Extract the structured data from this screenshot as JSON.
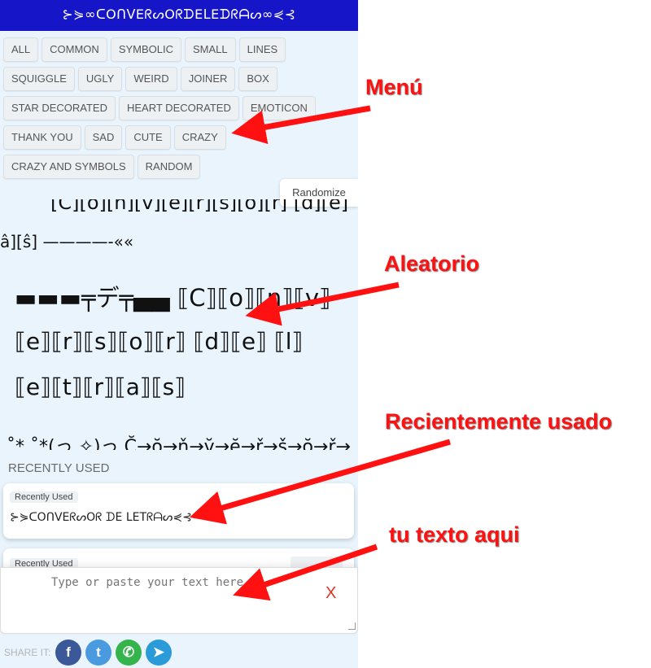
{
  "header": {
    "title": "⊱⋟∞ᑕOᑎᐯEᖇᔕOᖇᗪEᒪEᗪᖇᗩᔕ∞⋞⊰"
  },
  "menu": {
    "items": [
      "ALL",
      "COMMON",
      "SYMBOLIC",
      "SMALL",
      "LINES",
      "SQUIGGLE",
      "UGLY",
      "WEIRD",
      "JOINER",
      "BOX",
      "STAR DECORATED",
      "HEART DECORATED",
      "EMOTICON",
      "THANK YOU",
      "SAD",
      "CUTE",
      "CRAZY",
      "CRAZY AND SYMBOLS",
      "RANDOM"
    ]
  },
  "randomize_label": "Randomize",
  "preview": {
    "lines": [
      "[C][o][n][v][e][r][s][o][r] [d][e]",
      "â][ŝ]    ————-««",
      "▬▬▬╤デ╤▄▄ ⟦C⟧⟦o⟧⟦n⟧⟦v⟧",
      "⟦e⟧⟦r⟧⟦s⟧⟦o⟧⟦r⟧ ⟦d⟧⟦e⟧ ⟦l⟧",
      "⟦e⟧⟦t⟧⟦r⟧⟦a⟧⟦s⟧",
      "˚*.˚*(っ ✧)っ C̆→ŏ→ň→v̆→ĕ→ř→š→ŏ→ř→"
    ]
  },
  "recently_used": {
    "title": "RECENTLY USED",
    "cards": [
      {
        "tag": "Recently Used",
        "text": "⊱⋟ᑕOᑎᐯEᖇᔕOᖇ ᗪE ᒪETᖇᗩᔕ⋞⊰"
      },
      {
        "tag": "Recently Used",
        "text": ""
      }
    ]
  },
  "input": {
    "placeholder": "Type or paste your text here :)",
    "clear_label": "X"
  },
  "share": {
    "label": "SHARE IT:",
    "buttons": [
      {
        "name": "facebook",
        "glyph": "f",
        "color": "#3b5998"
      },
      {
        "name": "twitter",
        "glyph": "t",
        "color": "#4a9ae0"
      },
      {
        "name": "whatsapp",
        "glyph": "✆",
        "color": "#34b44a"
      },
      {
        "name": "telegram",
        "glyph": "➤",
        "color": "#2a9ad8"
      }
    ]
  },
  "annotations": {
    "menu": "Menú",
    "aleatorio": "Aleatorio",
    "recent": "Recientemente usado",
    "input": "tu texto aqui"
  },
  "colors": {
    "header_bg": "#1616c8",
    "app_bg": "#e9f4fd",
    "annotation": "#ff1111"
  }
}
